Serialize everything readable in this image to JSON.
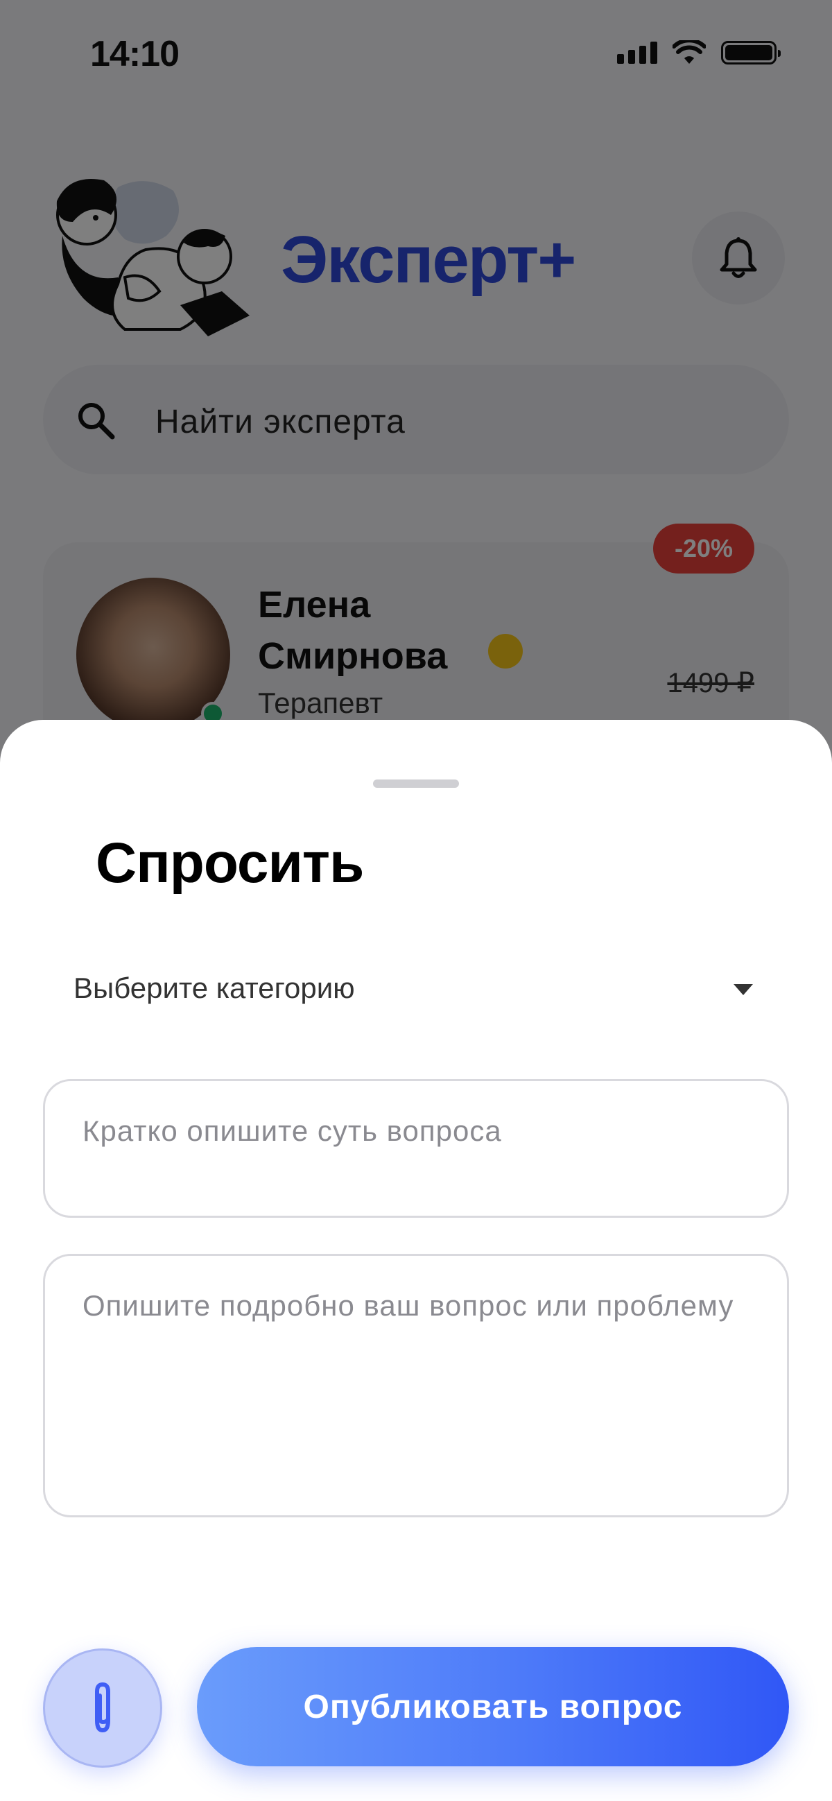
{
  "status_bar": {
    "time": "14:10"
  },
  "header": {
    "brand": "Эксперт+"
  },
  "search": {
    "placeholder": "Найти эксперта"
  },
  "expert_card": {
    "discount": "-20%",
    "name": "Елена Смирнова",
    "role": "Терапевт",
    "old_price": "1499 ₽"
  },
  "ask_sheet": {
    "title": "Спросить",
    "category_placeholder": "Выберите категорию",
    "short_placeholder": "Кратко опишите суть вопроса",
    "long_placeholder": "Опишите подробно ваш вопрос или проблему",
    "publish_label": "Опубликовать вопрос"
  },
  "icons": {
    "search": "search-icon",
    "bell": "bell-icon",
    "dropdown": "chevron-down-icon",
    "attach": "paperclip-icon"
  },
  "colors": {
    "brand": "#2f48d8",
    "accent_start": "#6a9cfb",
    "accent_end": "#3057f6",
    "discount": "#e8413a",
    "online": "#1cb36b"
  }
}
